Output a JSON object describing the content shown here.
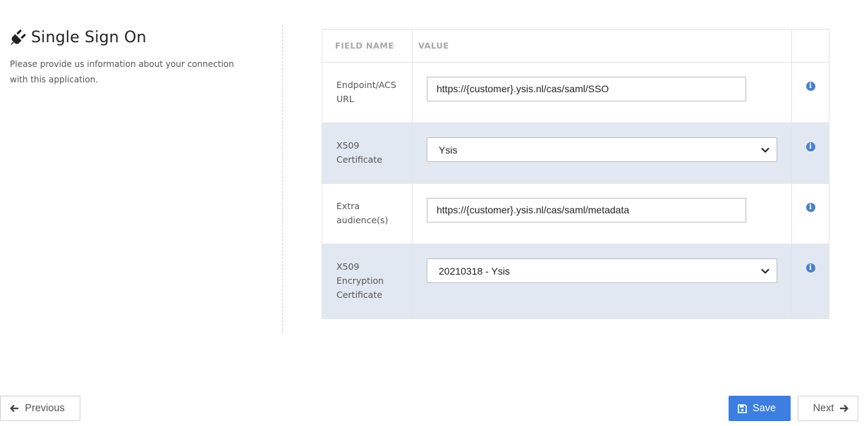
{
  "header": {
    "icon": "plug-icon",
    "title": "Single Sign On",
    "description": "Please provide us information about your connection with this application."
  },
  "table": {
    "columns": [
      "FIELD NAME",
      "VALUE",
      ""
    ],
    "rows": [
      {
        "label": "Endpoint/ACS URL",
        "type": "text",
        "value": "https://{customer}.ysis.nl/cas/saml/SSO",
        "info_icon": "info-circle-icon"
      },
      {
        "label": "X509 Certificate",
        "type": "select",
        "value": "Ysis",
        "info_icon": "info-circle-icon"
      },
      {
        "label": "Extra audience(s)",
        "type": "text",
        "value": "https://{customer}.ysis.nl/cas/saml/metadata",
        "info_icon": "info-circle-icon"
      },
      {
        "label": "X509 Encryption Certificate",
        "type": "select",
        "value": "20210318 - Ysis",
        "info_icon": "info-circle-icon"
      }
    ]
  },
  "footer": {
    "previous_label": "Previous",
    "save_label": "Save",
    "next_label": "Next"
  },
  "colors": {
    "accent": "#3d7ee0",
    "info_icon": "#4a7fce",
    "striped_row": "#e2e8f2"
  }
}
